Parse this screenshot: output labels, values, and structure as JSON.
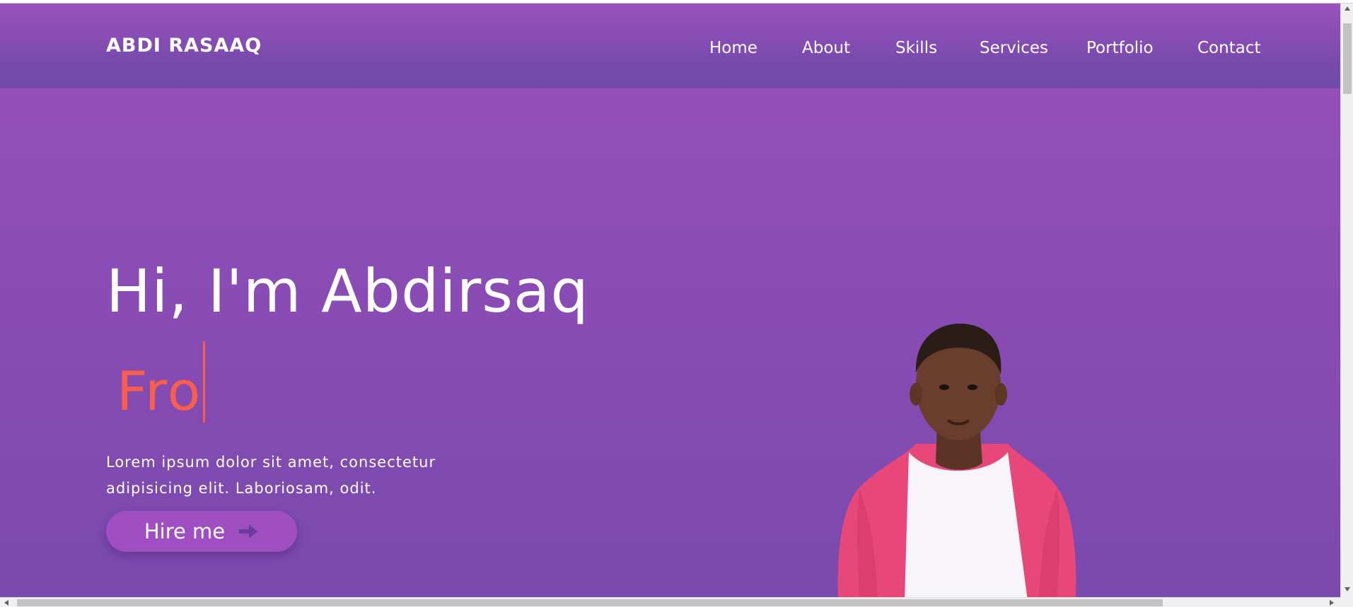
{
  "brand": {
    "name": "ABDI RASAAQ"
  },
  "nav": {
    "items": [
      {
        "label": "Home"
      },
      {
        "label": "About"
      },
      {
        "label": "Skills"
      },
      {
        "label": "Services"
      },
      {
        "label": "Portfolio"
      },
      {
        "label": "Contact"
      }
    ]
  },
  "hero": {
    "title": "Hi, I'm Abdirsaq",
    "typed_text": "Fro",
    "description": "Lorem ipsum dolor sit amet, consectetur adipisicing elit. Laboriosam, odit.",
    "button_label": "Hire me",
    "button_icon": "arrow-right-icon"
  },
  "colors": {
    "background_top": "#9a4fbc",
    "background_bottom": "#7a4aae",
    "accent": "#fb5e4b",
    "button": "#a04fc2"
  }
}
